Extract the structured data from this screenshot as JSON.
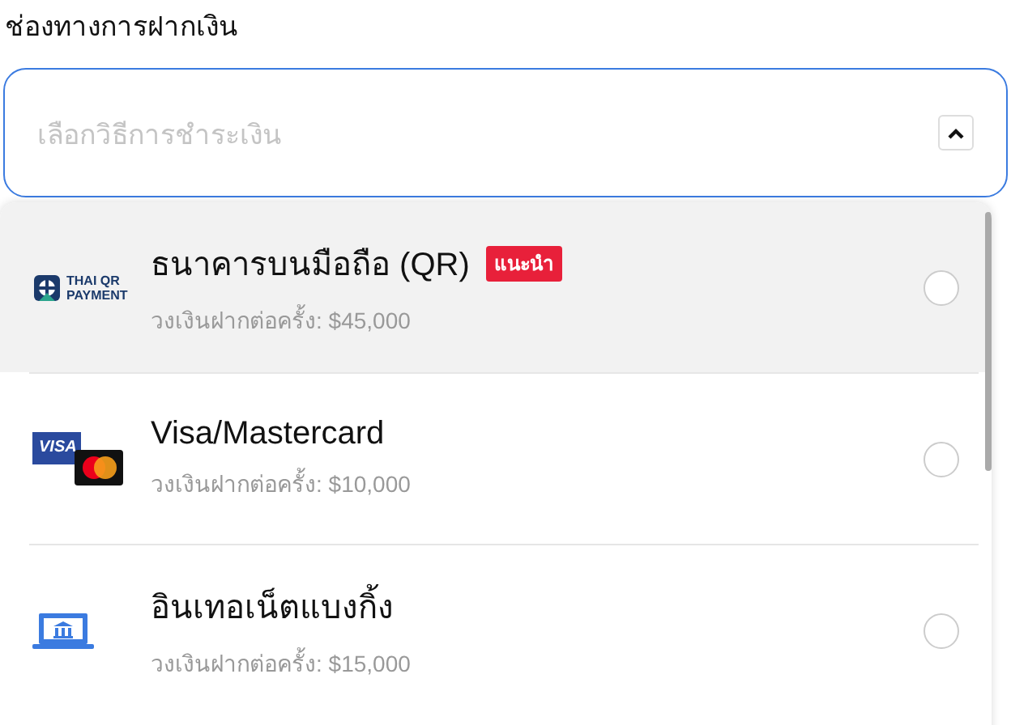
{
  "field_label": "ช่องทางการฝากเงิน",
  "select": {
    "placeholder": "เลือกวิธีการชำระเงิน",
    "expanded": true
  },
  "options": [
    {
      "kind": "qr",
      "logo_text": [
        "THAI QR",
        "PAYMENT"
      ],
      "title": "ธนาคารบนมือถือ (QR)",
      "badge": "แนะนำ",
      "limit": "วงเงินฝากต่อครั้ง: $45,000",
      "highlighted": true,
      "selected": false
    },
    {
      "kind": "card",
      "logo_text": [
        "VISA"
      ],
      "title": "Visa/Mastercard",
      "limit": "วงเงินฝากต่อครั้ง: $10,000",
      "highlighted": false,
      "selected": false
    },
    {
      "kind": "bank",
      "title": "อินเทอเน็ตแบงกิ้ง",
      "limit": "วงเงินฝากต่อครั้ง: $15,000",
      "highlighted": false,
      "selected": false
    }
  ]
}
